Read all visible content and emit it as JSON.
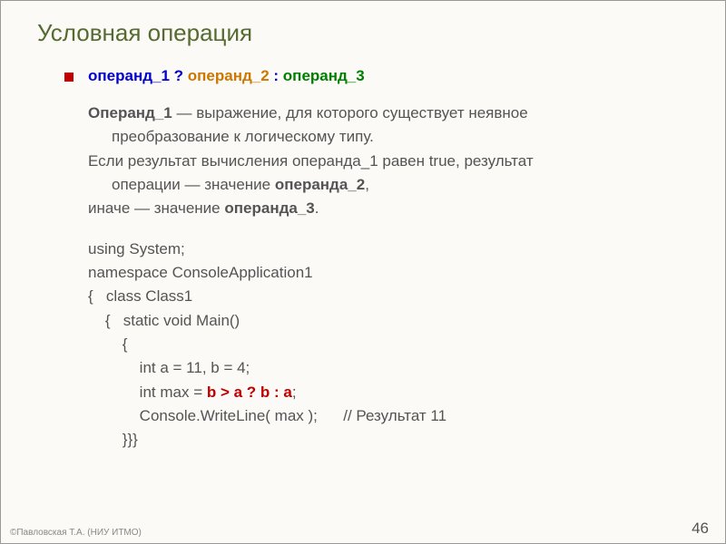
{
  "title": "Условная операция",
  "syntax": {
    "operand1": "операнд_1",
    "q": " ? ",
    "operand2": "операнд_2",
    "c": " : ",
    "operand3": "операнд_3"
  },
  "desc": {
    "line1_lead": "Операнд_1",
    "line1_rest": " — выражение, для которого существует неявное",
    "line2": "преобразование к логическому типу.",
    "line3_a": "Если результат вычисления операнда_1 равен true, результат",
    "line4_a": "операции — значение ",
    "line4_b": "операнда_2",
    "line4_c": ",",
    "line5_a": "иначе — значение ",
    "line5_b": "операнда_3",
    "line5_c": "."
  },
  "code": {
    "l1": "using System;",
    "l2": "namespace ConsoleApplication1",
    "l3": "{   class Class1",
    "l4": "    {   static void Main()",
    "l5": "        {",
    "l6": "            int a = 11, b = 4;",
    "l7a": "            int max = ",
    "l7b": "b > a ? b : a",
    "l7c": ";",
    "l8a": "            Console.WriteLine( max );      ",
    "l8b": "// Результат 11",
    "l9": "        }}}"
  },
  "footer": "©Павловская Т.А. (НИУ ИТМО)",
  "page": "46"
}
